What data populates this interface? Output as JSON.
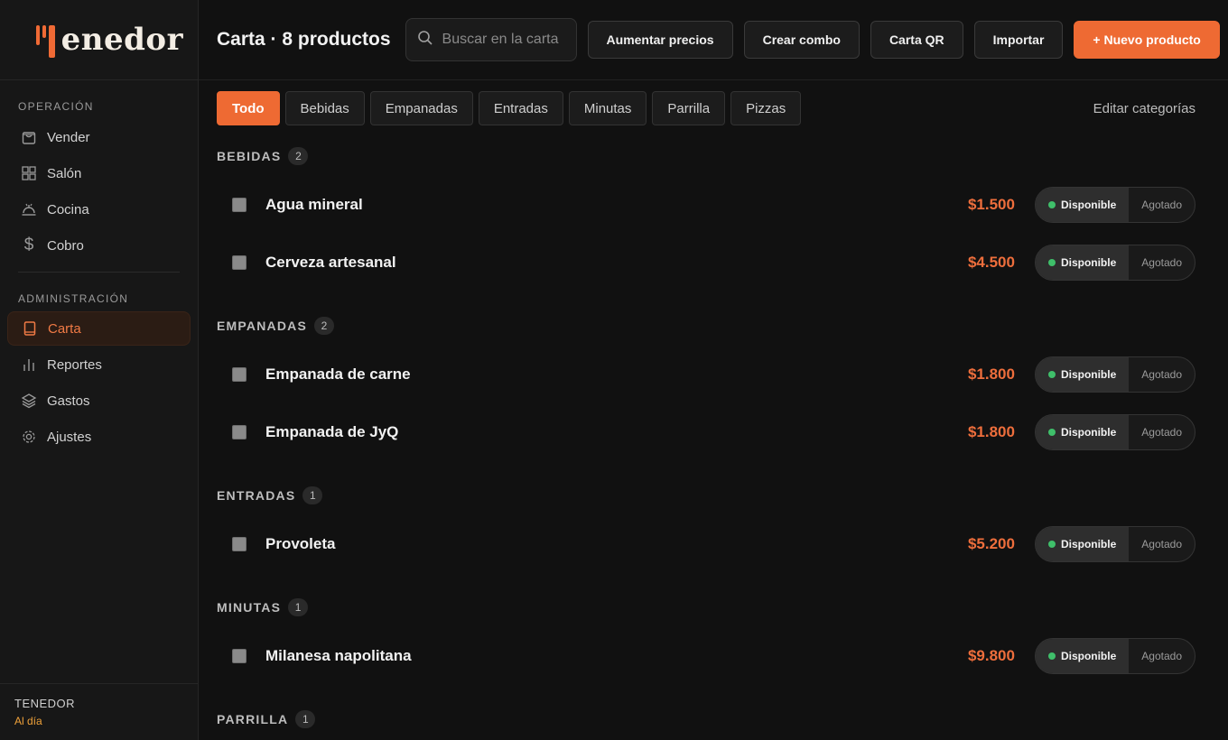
{
  "app": {
    "brand_footer": "TENEDOR",
    "status": "Al día",
    "logo_text": "enedor",
    "accent": "#ee6a33"
  },
  "sidebar": {
    "sections": [
      {
        "heading": "OPERACIÓN",
        "items": [
          {
            "label": "Vender",
            "icon": "shopping-bag-icon"
          },
          {
            "label": "Salón",
            "icon": "grid-icon"
          },
          {
            "label": "Cocina",
            "icon": "cloche-icon"
          },
          {
            "label": "Cobro",
            "icon": "dollar-icon"
          }
        ]
      },
      {
        "heading": "ADMINISTRACIÓN",
        "items": [
          {
            "label": "Carta",
            "icon": "book-icon",
            "active": true
          },
          {
            "label": "Reportes",
            "icon": "bar-chart-icon"
          },
          {
            "label": "Gastos",
            "icon": "layers-icon"
          },
          {
            "label": "Ajustes",
            "icon": "gear-icon"
          }
        ]
      }
    ]
  },
  "header": {
    "title": "Carta · 8 productos",
    "search_placeholder": "Buscar en la carta",
    "buttons": {
      "raise_prices": "Aumentar precios",
      "create_combo": "Crear combo",
      "qr_menu": "Carta QR",
      "import": "Importar",
      "new_product": "+ Nuevo producto"
    }
  },
  "filters": {
    "chips": [
      "Todo",
      "Bebidas",
      "Empanadas",
      "Entradas",
      "Minutas",
      "Parrilla",
      "Pizzas"
    ],
    "active": "Todo",
    "edit_label": "Editar categorías"
  },
  "availability": {
    "on_label": "Disponible",
    "off_label": "Agotado",
    "on_color": "#3fbf6a"
  },
  "groups": [
    {
      "name": "BEBIDAS",
      "count": "2",
      "products": [
        {
          "name": "Agua mineral",
          "price": "$1.500",
          "available": true
        },
        {
          "name": "Cerveza artesanal",
          "price": "$4.500",
          "available": true
        }
      ]
    },
    {
      "name": "EMPANADAS",
      "count": "2",
      "products": [
        {
          "name": "Empanada de carne",
          "price": "$1.800",
          "available": true
        },
        {
          "name": "Empanada de JyQ",
          "price": "$1.800",
          "available": true
        }
      ]
    },
    {
      "name": "ENTRADAS",
      "count": "1",
      "products": [
        {
          "name": "Provoleta",
          "price": "$5.200",
          "available": true
        }
      ]
    },
    {
      "name": "MINUTAS",
      "count": "1",
      "products": [
        {
          "name": "Milanesa napolitana",
          "price": "$9.800",
          "available": true
        }
      ]
    },
    {
      "name": "PARRILLA",
      "count": "1",
      "products": []
    }
  ]
}
